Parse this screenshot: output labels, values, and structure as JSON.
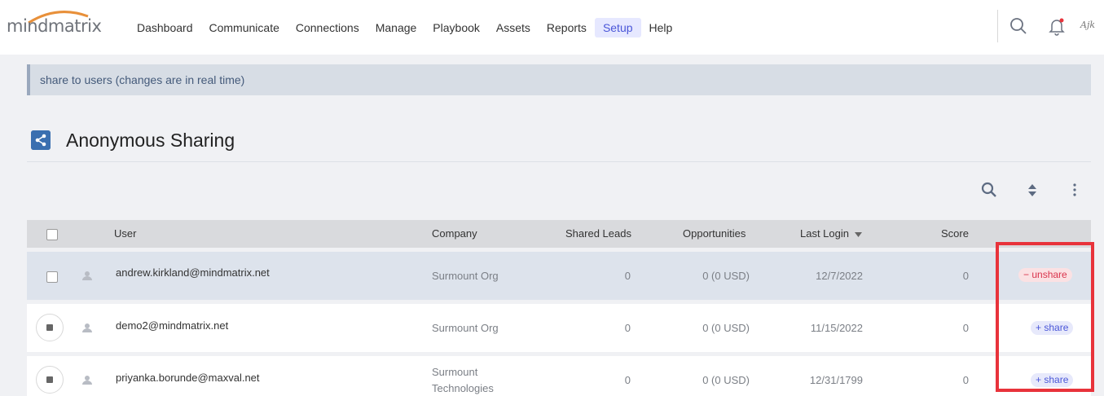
{
  "brand": {
    "logo_text": "mindmatrix",
    "accent": "#e8903a"
  },
  "nav": {
    "items": [
      "Dashboard",
      "Communicate",
      "Connections",
      "Manage",
      "Playbook",
      "Assets",
      "Reports",
      "Setup",
      "Help"
    ],
    "active": "Setup",
    "icons": [
      "search-icon",
      "bell-icon",
      "user-signature-avatar"
    ],
    "avatar_text": "Ajk"
  },
  "info_bar": {
    "text": "share to users (changes are in real time)"
  },
  "page": {
    "title": "Anonymous Sharing",
    "title_icon": "share-icon"
  },
  "toolbar": {
    "icons": [
      "search-icon",
      "sort-icon",
      "more-vertical-icon"
    ]
  },
  "table": {
    "headers": {
      "user": "User",
      "company": "Company",
      "shared_leads": "Shared Leads",
      "opportunities": "Opportunities",
      "last_login": "Last Login",
      "score": "Score"
    },
    "rows": [
      {
        "user": "andrew.kirkland@mindmatrix.net",
        "company": "Surmount Org",
        "company2": "",
        "shared_leads": "0",
        "opportunities": "0 (0 USD)",
        "last_login": "12/7/2022",
        "score": "0",
        "action": "unshare"
      },
      {
        "user": "demo2@mindmatrix.net",
        "company": "Surmount Org",
        "company2": "",
        "shared_leads": "0",
        "opportunities": "0 (0 USD)",
        "last_login": "11/15/2022",
        "score": "0",
        "action": "share"
      },
      {
        "user": "priyanka.borunde@maxval.net",
        "company": "Surmount",
        "company2": "Technologies",
        "shared_leads": "0",
        "opportunities": "0 (0 USD)",
        "last_login": "12/31/1799",
        "score": "0",
        "action": "share"
      }
    ]
  },
  "colors": {
    "unshare": "#d9344c",
    "share": "#4a56d8",
    "highlight_box": "#e8333b"
  }
}
